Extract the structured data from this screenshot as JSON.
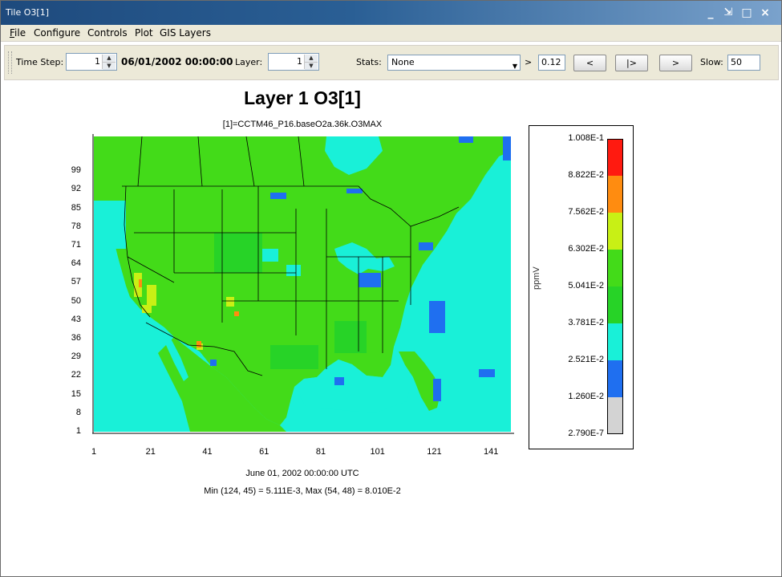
{
  "window": {
    "title": "Tile O3[1]",
    "controls": [
      "_",
      "⇲",
      "□",
      "×"
    ]
  },
  "menu": [
    {
      "label_ul": "F",
      "label_rest": "ile"
    },
    {
      "label_ul": "",
      "label_rest": "Configure"
    },
    {
      "label_ul": "",
      "label_rest": "Controls"
    },
    {
      "label_ul": "",
      "label_rest": "Plot"
    },
    {
      "label_ul": "",
      "label_rest": "GIS Layers"
    }
  ],
  "toolbar": {
    "time_step_label": "Time Step:",
    "time_step_value": "1",
    "datetime": "06/01/2002 00:00:00",
    "layer_label": "Layer:",
    "layer_value": "1",
    "stats_label": "Stats:",
    "stats_value": "None",
    "gt_label": ">",
    "threshold_value": "0.12",
    "prev_label": "<",
    "play_label": "|>",
    "next_label": ">",
    "slow_label": "Slow:",
    "slow_value": "50"
  },
  "plot": {
    "title": "Layer 1 O3[1]",
    "subtitle": "[1]=CCTM46_P16.baseO2a.36k.O3MAX",
    "date_caption": "June 01, 2002 00:00:00 UTC",
    "minmax_caption": "Min (124, 45) = 5.111E-3, Max (54, 48) = 8.010E-2"
  },
  "chart_data": {
    "type": "heatmap",
    "title": "Layer 1 O3[1]",
    "subtitle": "[1]=CCTM46_P16.baseO2a.36k.O3MAX",
    "xlabel": "",
    "ylabel": "",
    "x_ticks": [
      "1",
      "21",
      "41",
      "61",
      "81",
      "101",
      "121",
      "141"
    ],
    "y_ticks": [
      "1",
      "8",
      "15",
      "22",
      "29",
      "36",
      "43",
      "50",
      "57",
      "64",
      "71",
      "78",
      "85",
      "92",
      "99"
    ],
    "xlim": [
      1,
      148
    ],
    "ylim": [
      1,
      112
    ],
    "legend": {
      "unit": "ppmV",
      "breaks": [
        "2.790E-7",
        "1.260E-2",
        "2.521E-2",
        "3.781E-2",
        "5.041E-2",
        "6.302E-2",
        "7.562E-2",
        "8.822E-2",
        "1.008E-1"
      ],
      "colors": [
        "#d3d3d3",
        "#1f6ff0",
        "#19f0d8",
        "#27d327",
        "#43db19",
        "#c8f015",
        "#ff8c10",
        "#ff1a10"
      ]
    },
    "min": {
      "col": 124,
      "row": 45,
      "value": "5.111E-3"
    },
    "max": {
      "col": 54,
      "row": 48,
      "value": "8.010E-2"
    }
  },
  "colors": {
    "ocean": "#19f0d8",
    "land_green": "#43db19",
    "land_green_dark": "#27d327",
    "low_blue": "#1f6ff0",
    "yellow": "#c8f015",
    "orange": "#ff8c10"
  }
}
